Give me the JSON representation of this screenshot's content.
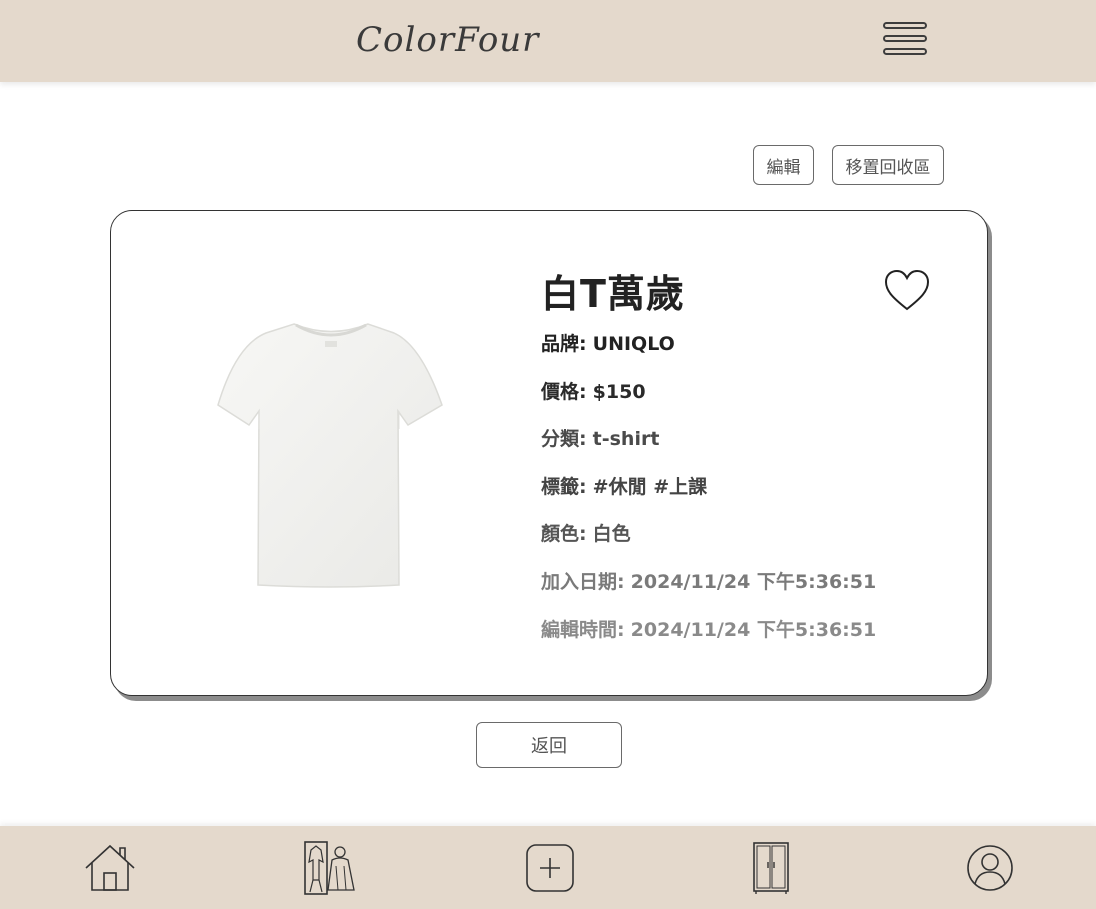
{
  "header": {
    "logo_text": "ColorFour",
    "menu_icon": "hamburger-menu-icon"
  },
  "actions": {
    "edit_label": "編輯",
    "move_to_trash_label": "移置回收區"
  },
  "item": {
    "name": "白T萬歲",
    "favorite_icon": "heart-outline-icon",
    "image_icon": "white-tshirt-image",
    "brand_label": "品牌:",
    "brand_value": "UNIQLO",
    "price_label": "價格:",
    "price_value": "$150",
    "category_label": "分類:",
    "category_value": "t-shirt",
    "tags_label": "標籤:",
    "tags_value": "#休閒 #上課",
    "color_label": "顏色:",
    "color_value": "白色",
    "added_label": "加入日期:",
    "added_value": "2024/11/24 下午5:36:51",
    "edited_label": "編輯時間:",
    "edited_value": "2024/11/24 下午5:36:51"
  },
  "back_label": "返回",
  "bottom_nav": {
    "items": [
      {
        "icon": "home-icon"
      },
      {
        "icon": "outfit-icon"
      },
      {
        "icon": "add-icon"
      },
      {
        "icon": "wardrobe-icon"
      },
      {
        "icon": "profile-icon"
      }
    ]
  },
  "colors": {
    "bar_background": "#e4d9cc",
    "text_primary": "#222222",
    "text_muted": "#7a7a7a",
    "border": "#333333"
  }
}
